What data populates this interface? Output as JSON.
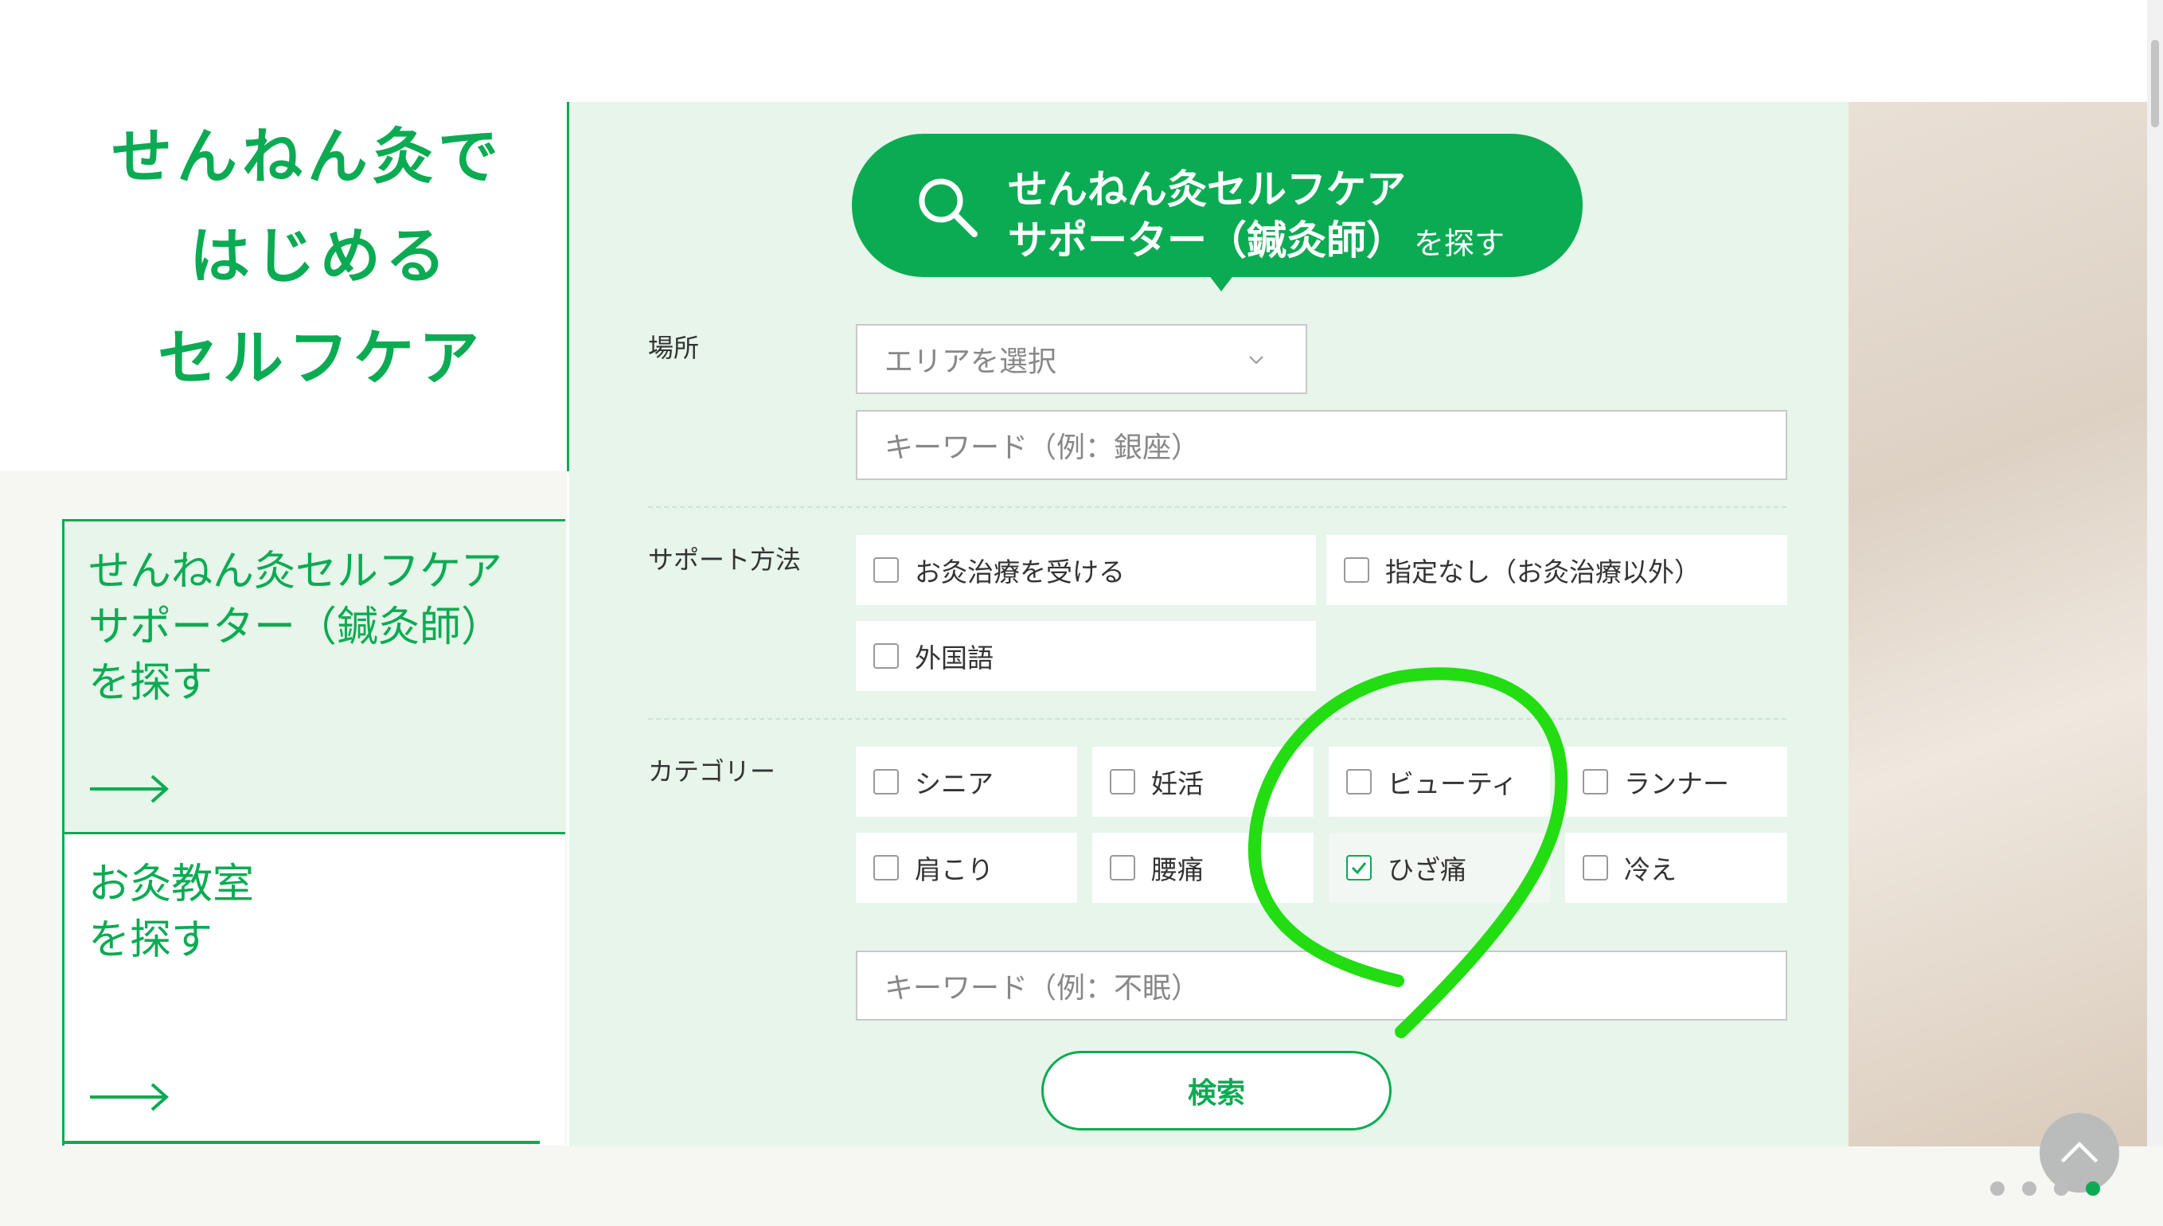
{
  "hero": {
    "lines": [
      "せんねん灸で",
      "はじめる",
      "セルフケア"
    ]
  },
  "left_cards": [
    {
      "lines": [
        "せんねん灸セルフケア",
        "サポーター（鍼灸師）",
        "を探す"
      ]
    },
    {
      "lines": [
        "お灸教室",
        "を探す"
      ]
    }
  ],
  "search_title": {
    "line1": "せんねん灸セルフケア",
    "line2": "サポーター（鍼灸師）",
    "suffix": "を探す",
    "icon": "search-icon"
  },
  "form": {
    "location": {
      "label": "場所",
      "area_select": "エリアを選択",
      "keyword_placeholder": "キーワード（例：銀座）"
    },
    "support": {
      "label": "サポート方法",
      "options": [
        {
          "label": "お灸治療を受ける",
          "checked": false
        },
        {
          "label": "指定なし（お灸治療以外）",
          "checked": false
        },
        {
          "label": "外国語",
          "checked": false
        }
      ]
    },
    "category": {
      "label": "カテゴリー",
      "options": [
        {
          "label": "シニア",
          "checked": false
        },
        {
          "label": "妊活",
          "checked": false
        },
        {
          "label": "ビューティ",
          "checked": false
        },
        {
          "label": "ランナー",
          "checked": false
        },
        {
          "label": "肩こり",
          "checked": false
        },
        {
          "label": "腰痛",
          "checked": false
        },
        {
          "label": "ひざ痛",
          "checked": true
        },
        {
          "label": "冷え",
          "checked": false
        }
      ],
      "keyword_placeholder": "キーワード（例：不眠）"
    },
    "submit_label": "検索"
  },
  "colors": {
    "brand_green": "#0bab53",
    "panel_bg": "#e7f5ea",
    "highlight_yellow": "#fbf1a6",
    "annotation_green": "#22dd11"
  },
  "carousel": {
    "dots": 4,
    "active_index": 3
  }
}
